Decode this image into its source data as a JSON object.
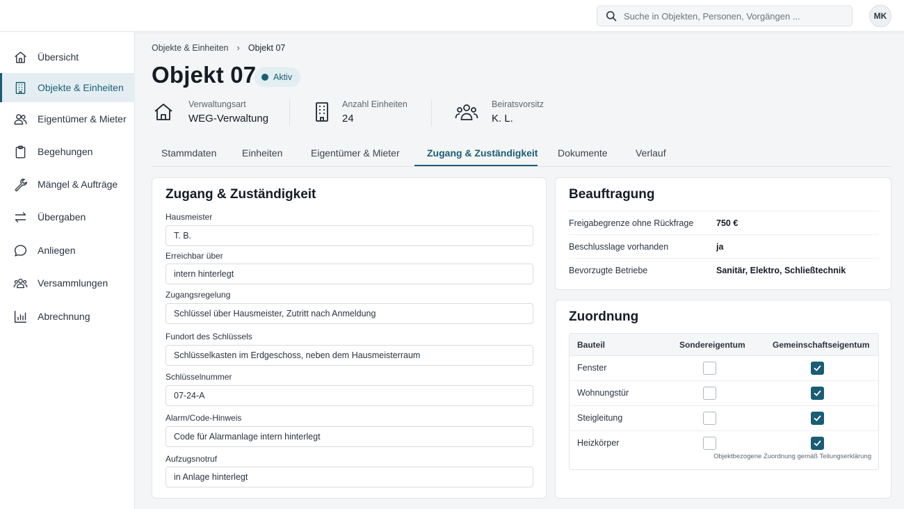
{
  "header": {
    "search_placeholder": "Suche in Objekten, Personen, Vorgängen ...",
    "avatar_initials": "MK"
  },
  "sidebar": {
    "items": [
      {
        "label": "Übersicht",
        "icon": "home-icon"
      },
      {
        "label": "Objekte & Einheiten",
        "icon": "building-icon",
        "active": true
      },
      {
        "label": "Eigentümer & Mieter",
        "icon": "users-icon"
      },
      {
        "label": "Begehungen",
        "icon": "clipboard-icon"
      },
      {
        "label": "Mängel & Aufträge",
        "icon": "wrench-icon"
      },
      {
        "label": "Übergaben",
        "icon": "swap-icon"
      },
      {
        "label": "Anliegen",
        "icon": "chat-icon"
      },
      {
        "label": "Versammlungen",
        "icon": "group-icon"
      },
      {
        "label": "Abrechnung",
        "icon": "bar-chart-icon"
      }
    ]
  },
  "breadcrumb": {
    "parent": "Objekte & Einheiten",
    "separator": "›",
    "current": "Objekt 07"
  },
  "page": {
    "title": "Objekt 07",
    "status": "Aktiv"
  },
  "facts": [
    {
      "label": "Verwaltungsart",
      "value": "WEG-Verwaltung",
      "icon": "house-icon"
    },
    {
      "label": "Anzahl Einheiten",
      "value": "24",
      "icon": "building-icon"
    },
    {
      "label": "Beiratsvorsitz",
      "value": "K. L.",
      "icon": "group-icon"
    }
  ],
  "tabs": [
    {
      "label": "Stammdaten"
    },
    {
      "label": "Einheiten"
    },
    {
      "label": "Eigentümer & Mieter"
    },
    {
      "label": "Zugang & Zuständigkeit",
      "active": true
    },
    {
      "label": "Dokumente"
    },
    {
      "label": "Verlauf"
    }
  ],
  "access_card": {
    "title": "Zugang & Zuständigkeit",
    "fields": [
      {
        "label": "Hausmeister",
        "value": "T. B."
      },
      {
        "label": "Erreichbar über",
        "value": "intern hinterlegt"
      },
      {
        "label": "Zugangsregelung",
        "value": "Schlüssel über Hausmeister, Zutritt nach Anmeldung"
      },
      {
        "label": "Fundort des Schlüssels",
        "value": "Schlüsselkasten im Erdgeschoss, neben dem Hausmeisterraum"
      },
      {
        "label": "Schlüsselnummer",
        "value": "07-24-A"
      },
      {
        "label": "Alarm/Code-Hinweis",
        "value": "Code für Alarmanlage intern hinterlegt"
      },
      {
        "label": "Aufzugsnotruf",
        "value": "in Anlage hinterlegt"
      }
    ]
  },
  "mandate_card": {
    "title": "Beauftragung",
    "rows": [
      {
        "label": "Freigabegrenze ohne Rückfrage",
        "value": "750 €"
      },
      {
        "label": "Beschlusslage vorhanden",
        "value": "ja"
      },
      {
        "label": "Bevorzugte Betriebe",
        "value": "Sanitär, Elektro, Schließtechnik"
      }
    ]
  },
  "assignment_card": {
    "title": "Zuordnung",
    "columns": [
      "Bauteil",
      "Sondereigentum",
      "Gemeinschaftseigentum"
    ],
    "rows": [
      {
        "name": "Fenster",
        "sondereigentum": false,
        "gemeinschaftseigentum": true
      },
      {
        "name": "Wohnungstür",
        "sondereigentum": false,
        "gemeinschaftseigentum": true
      },
      {
        "name": "Steigleitung",
        "sondereigentum": false,
        "gemeinschaftseigentum": true
      },
      {
        "name": "Heizkörper",
        "sondereigentum": false,
        "gemeinschaftseigentum": true
      }
    ],
    "note": "Objektbezogene Zuordnung gemäß Teilungserklärung"
  },
  "colors": {
    "accent": "#1a5d74",
    "active_nav_bg": "#e4eef2",
    "page_bg": "#f3f5f6"
  }
}
